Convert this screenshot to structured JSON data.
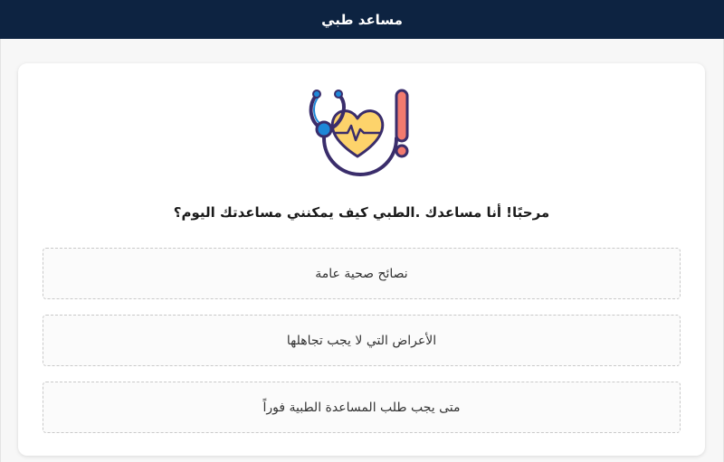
{
  "header": {
    "title": "مساعد طبي",
    "background": "#0d2341"
  },
  "card": {
    "logo_icon": "stethoscope-heart-alert-icon",
    "welcome_text": "مرحبًا! أنا مساعدك .الطبي كيف يمكنني مساعدتك اليوم؟"
  },
  "options": [
    {
      "label": "نصائح صحية عامة"
    },
    {
      "label": "الأعراض التي لا يجب تجاهلها"
    },
    {
      "label": "متى يجب طلب المساعدة الطبية فوراً"
    }
  ],
  "colors": {
    "heart": "#fdd36b",
    "stethoscope": "#1e88d8",
    "alert": "#f27a6e",
    "outline": "#3a2d6b"
  }
}
